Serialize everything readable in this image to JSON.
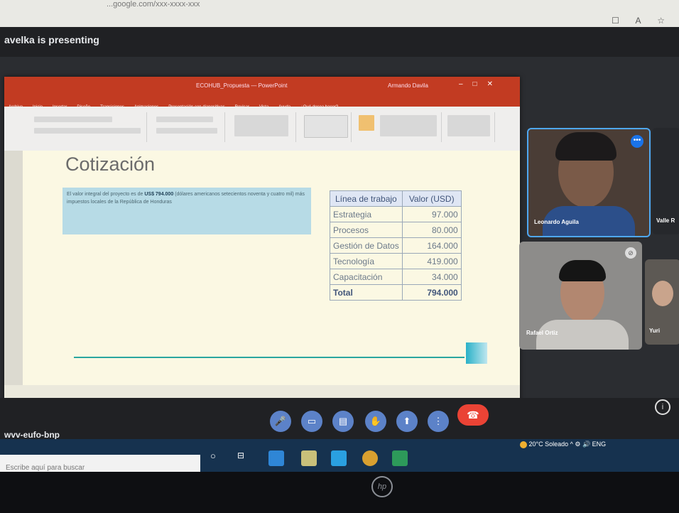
{
  "browser": {
    "url": "...google.com/xxx-xxxx-xxx",
    "icons": "☐ A ☆"
  },
  "meeting": {
    "presenting_label": "avelka is presenting",
    "code": "wvv-eufo-bnp",
    "controls": [
      "mic",
      "camera",
      "captions",
      "raise-hand",
      "present",
      "more"
    ],
    "participants": [
      {
        "name": "Leonardo Aguila",
        "active": true
      },
      {
        "name": "Rafael Ortiz",
        "active": false
      },
      {
        "name": "Valle R",
        "active": false
      },
      {
        "name": "Yuri",
        "active": false
      }
    ]
  },
  "powerpoint": {
    "title": "ECOHUB_Propuesta — PowerPoint",
    "user": "Armando Davila",
    "menu": [
      "Archivo",
      "Inicio",
      "Insertar",
      "Diseño",
      "Transiciones",
      "Animaciones",
      "Presentación con diapositivas",
      "Revisar",
      "Vista",
      "Ayuda",
      "¿Qué desea hacer?"
    ],
    "slide": {
      "title": "Cotización",
      "text_pre": "El valor integral del proyecto es de ",
      "text_bold": "US$ 794.000",
      "text_post": " (dólares americanos setecientos noventa y cuatro mil) más impuestos locales de la República de Honduras",
      "table": {
        "headers": [
          "Línea de trabajo",
          "Valor (USD)"
        ],
        "rows": [
          [
            "Estrategia",
            "97.000"
          ],
          [
            "Procesos",
            "80.000"
          ],
          [
            "Gestión de Datos",
            "164.000"
          ],
          [
            "Tecnología",
            "419.000"
          ],
          [
            "Capacitación",
            "34.000"
          ]
        ],
        "total_label": "Total",
        "total_value": "794.000"
      }
    }
  },
  "taskbar": {
    "search_placeholder": "Escribe aquí para buscar",
    "weather": "20°C Soleado",
    "tray": "^ ⚙ 🔊 ENG"
  },
  "laptop": {
    "logo": "hp"
  }
}
